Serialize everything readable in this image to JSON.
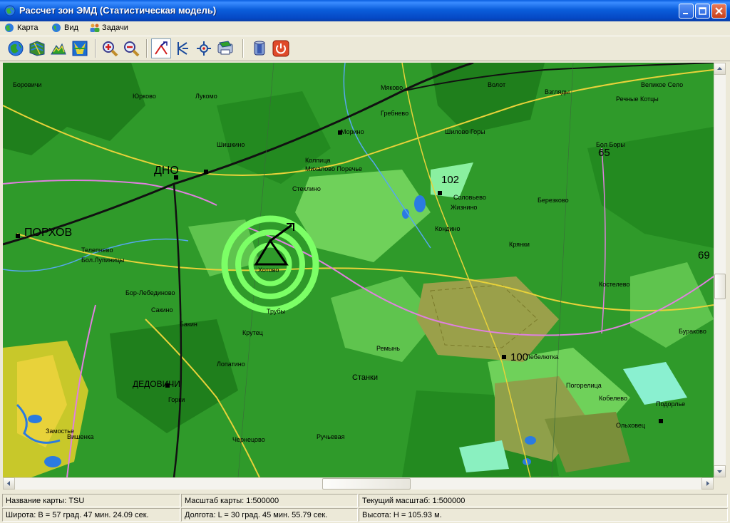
{
  "window": {
    "title": "Рассчет зон ЭМД (Статистическая модель)"
  },
  "menu": [
    {
      "label": "Карта",
      "icon": "globe-icon"
    },
    {
      "label": "Вид",
      "icon": "globe-view-icon"
    },
    {
      "label": "Задачи",
      "icon": "users-icon"
    }
  ],
  "toolbar": [
    {
      "name": "map-globe-button",
      "icon": "globe-icon"
    },
    {
      "name": "map-layer-button",
      "icon": "map-layer-icon"
    },
    {
      "name": "map-relief-button",
      "icon": "relief-icon"
    },
    {
      "name": "map-vector-button",
      "icon": "vector-map-icon"
    },
    {
      "name": "zoom-in-button",
      "icon": "zoom-in-icon"
    },
    {
      "name": "zoom-out-button",
      "icon": "zoom-out-icon"
    },
    {
      "name": "place-emitter-button",
      "icon": "antenna-icon"
    },
    {
      "name": "place-receiver-button",
      "icon": "receiver-icon"
    },
    {
      "name": "station-button",
      "icon": "station-icon"
    },
    {
      "name": "map-print-button",
      "icon": "map-print-icon"
    },
    {
      "name": "database-button",
      "icon": "database-icon"
    },
    {
      "name": "exit-button",
      "icon": "power-icon"
    }
  ],
  "map": {
    "cities": [
      "ПОРХОВ",
      "ДНО",
      "ДЕДОВИЧИ"
    ],
    "elevations": [
      "102",
      "65",
      "69",
      "100"
    ],
    "labels": [
      "Боровичи",
      "Юрково",
      "Лукомо",
      "Мяково",
      "Волот",
      "Взгляды",
      "Великое Село",
      "Речные Котцы",
      "Гребнево",
      "Бол Боры",
      "Морино",
      "Шилово Горы",
      "Шишкино",
      "Колпица",
      "Михалово Поречье",
      "Стеклино",
      "Соловьево",
      "Жизнино",
      "Березково",
      "Крянки",
      "Кондино",
      "Хотово",
      "Трубы",
      "Телепнево",
      "Бол.Лупиницы",
      "Бор-Лебединово",
      "Сакино",
      "Бакин",
      "Крутец",
      "Лопатино",
      "Станки",
      "Ремынь",
      "Лебелютка",
      "Горки",
      "Чернецово",
      "Ручьевая",
      "Погорелица",
      "Кобелево",
      "Подорлье",
      "Ольховец",
      "Костелево",
      "Бураково",
      "Замостье",
      "Вишенка"
    ]
  },
  "status": {
    "map_name": "Название карты: TSU",
    "map_scale": "Масштаб карты: 1:500000",
    "current_scale": "Текущий масштаб: 1:500000",
    "latitude": "Широта: B = 57 град. 47 мин. 24.09 сек.",
    "longitude": "Долгота: L = 30 град. 45 мин. 55.79 сек.",
    "height": "Высота: H = 105.93 м."
  },
  "colors": {
    "titlebar": "#0B5EDB",
    "map_green": "#2F9A2A",
    "map_light_green": "#6FD15A",
    "emd_zone": "#7CFF66",
    "water": "#2B7BE0"
  }
}
